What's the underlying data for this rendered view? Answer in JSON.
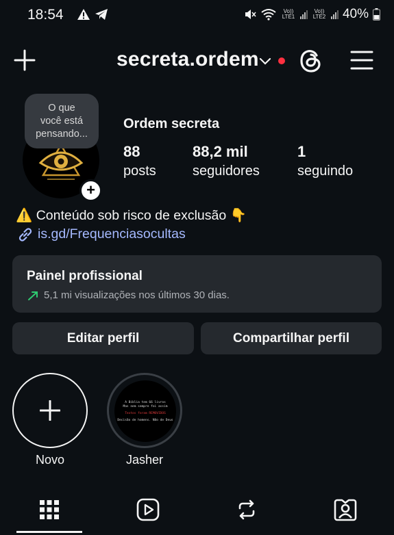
{
  "status_bar": {
    "time": "18:54",
    "battery": "40%",
    "net1": "Vo)) LTE1",
    "net2": "Vo)) LTE2"
  },
  "header": {
    "username": "secreta.ordem"
  },
  "profile": {
    "note": [
      "O que",
      "você está",
      "pensando..."
    ],
    "display_name": "Ordem secreta",
    "stats": [
      {
        "value": "88",
        "label": "posts"
      },
      {
        "value": "88,2 mil",
        "label": "seguidores"
      },
      {
        "value": "1",
        "label": "seguindo"
      }
    ],
    "bio": "⚠️ Conteúdo sob risco de exclusão 👇",
    "link": "is.gd/Frequenciasocultas"
  },
  "professional_panel": {
    "title": "Painel profissional",
    "subtitle": "5,1 mi visualizações nos últimos 30 dias."
  },
  "buttons": {
    "edit": "Editar perfil",
    "share": "Compartilhar perfil"
  },
  "highlights": [
    {
      "label": "Novo"
    },
    {
      "label": "Jasher",
      "cover_lines": [
        "A Bíblia tem 66 livros",
        "Mas nem sempre foi assim",
        "Textos foram REMOVIDOS",
        "Decisão de homens. Não de Deus"
      ]
    }
  ],
  "colors": {
    "background": "#0c1014",
    "card": "#25292e",
    "link": "#a5b9ff",
    "live_dot": "#ff3040",
    "trend_up": "#2ecc71"
  }
}
